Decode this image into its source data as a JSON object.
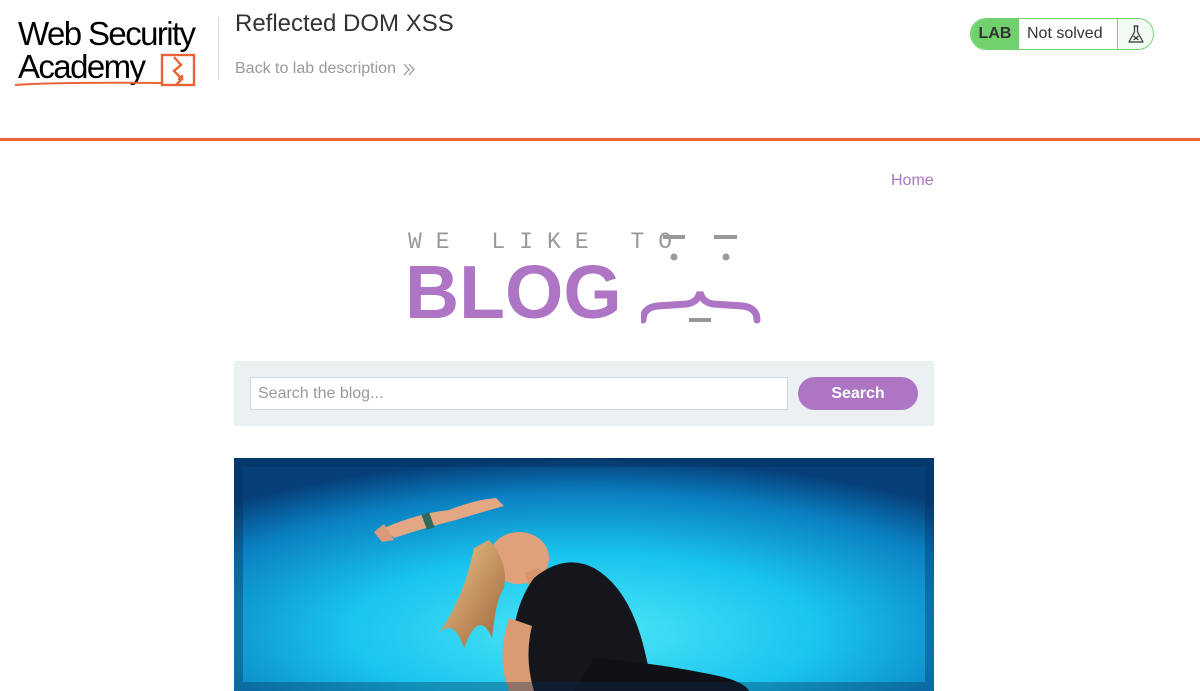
{
  "header": {
    "logo_line1": "Web Security",
    "logo_line2": "Academy",
    "lab_title": "Reflected DOM XSS",
    "back_link": "Back to lab description",
    "lab_badge": "LAB",
    "lab_status": "Not solved",
    "accent_color": "#ec6337",
    "status_color": "#70d16d"
  },
  "nav": {
    "home": "Home"
  },
  "banner": {
    "tagline": "WE LIKE TO",
    "title": "BLOG",
    "brand_color": "#ae75c5"
  },
  "search": {
    "placeholder": "Search the blog...",
    "button": "Search"
  },
  "post": {
    "image_icon": "woman-yoga-pose-photo"
  }
}
